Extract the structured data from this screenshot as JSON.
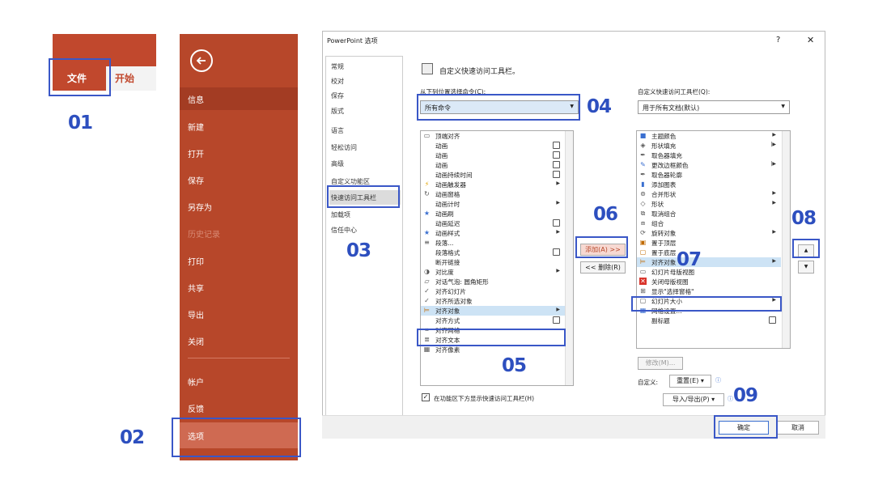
{
  "ribbon": {
    "tab_file": "文件",
    "tab_home": "开始"
  },
  "backstage": {
    "items": [
      "信息",
      "新建",
      "打开",
      "保存",
      "另存为",
      "历史记录",
      "打印",
      "共享",
      "导出",
      "关闭",
      "帐户",
      "反馈",
      "选项"
    ],
    "back_icon": "arrow-left-circle-icon"
  },
  "steps": [
    "01",
    "02",
    "03",
    "04",
    "05",
    "06",
    "07",
    "08",
    "09"
  ],
  "dialog": {
    "title": "PowerPoint 选项",
    "help": "?",
    "close": "✕",
    "nav": [
      "常规",
      "校对",
      "保存",
      "版式",
      "语言",
      "轻松访问",
      "高级",
      "自定义功能区",
      "快速访问工具栏",
      "加载项",
      "信任中心"
    ],
    "header": "自定义快速访问工具栏。",
    "choose_label": "从下列位置选择命令(C):",
    "choose_value": "所有命令",
    "customize_label": "自定义快速访问工具栏(Q):",
    "customize_value": "用于所有文档(默认)",
    "left_list": [
      "顶端对齐",
      "动画",
      "动画",
      "动画",
      "动画持续时间",
      "动画触发器",
      "动画窗格",
      "动画计时",
      "动画刷",
      "动画延迟",
      "动画样式",
      "段落...",
      "段落格式",
      "断开链接",
      "对比度",
      "对话气泡: 圆角矩形",
      "对齐幻灯片",
      "对齐所选对象",
      "对齐对象",
      "对齐方式",
      "对齐网格",
      "对齐文本",
      "对齐像素"
    ],
    "right_list": [
      "主题颜色",
      "形状填充",
      "取色器填充",
      "更改边框颜色",
      "取色器轮廓",
      "添加图表",
      "合并形状",
      "形状",
      "取消组合",
      "组合",
      "旋转对象",
      "置于顶层",
      "置于底层",
      "对齐对象",
      "幻灯片母版视图",
      "关闭母版视图",
      "显示\"选择窗格\"",
      "幻灯片大小",
      "网格设置...",
      "副标题"
    ],
    "add_btn": "添加(A) >>",
    "remove_btn": "<< 删除(R)",
    "modify_btn": "修改(M)...",
    "customizations_label": "自定义:",
    "reset_btn": "重置(E) ▾",
    "import_export_btn": "导入/导出(P) ▾",
    "show_below_label": "在功能区下方显示快速访问工具栏(H)",
    "ok_btn": "确定",
    "cancel_btn": "取消"
  },
  "colors": {
    "accent_red": "#b7472a",
    "highlight_blue": "#3a57c7",
    "selection": "#cde3f5"
  }
}
